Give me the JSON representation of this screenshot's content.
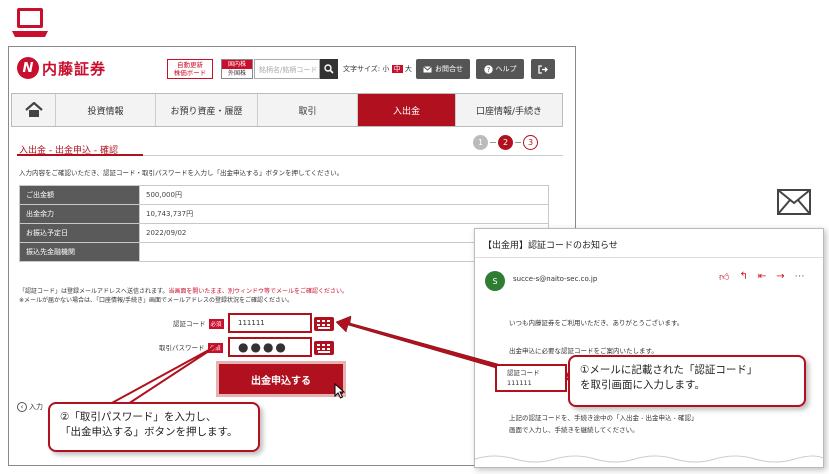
{
  "colors": {
    "brand": "#b1101f",
    "accent": "#c8102e",
    "mail_avatar": "#2e7d32"
  },
  "icons": {
    "laptop": "laptop-icon",
    "mail": "envelope-icon"
  },
  "header": {
    "logo_mark": "N",
    "logo_text": "内藤証券",
    "auto_update_line1": "自動更新",
    "auto_update_line2": "株価ボード",
    "market_top": "国内株",
    "market_bottom": "外国株",
    "search_placeholder": "銘柄名/銘柄コード",
    "font_size_label": "文字サイズ:",
    "font_small": "小",
    "font_medium": "中",
    "font_large": "大",
    "contact_label": "お問合せ",
    "help_label": "ヘルプ"
  },
  "nav": {
    "tabs": [
      {
        "label": "投資情報"
      },
      {
        "label": "お預り資産・履歴"
      },
      {
        "label": "取引"
      },
      {
        "label": "入出金"
      },
      {
        "label": "口座情報/手続き"
      }
    ]
  },
  "page": {
    "title": "入出金 - 出金申込 - 確認",
    "steps": [
      "1",
      "2",
      "3"
    ],
    "intro": "入力内容をご確認いただき、認証コード・取引パスワードを入力し「出金申込する」ボタンを押してください。"
  },
  "table": {
    "rows": [
      {
        "label": "ご出金額",
        "value": "500,000円"
      },
      {
        "label": "出金余力",
        "value": "10,743,737円"
      },
      {
        "label": "お振込予定日",
        "value": "2022/09/02"
      },
      {
        "label": "振込先金融機関",
        "value": ""
      }
    ]
  },
  "notes": {
    "line1_a": "「認証コード」は登録メールアドレスへ送信されます。",
    "line1_b": "当画面を開いたまま、別ウィンドウ等でメールをご確認ください。",
    "line2": "※メールが届かない場合は、「口座情報/手続き」画面でメールアドレスの登録状況をご確認ください。"
  },
  "form": {
    "code_label": "認証コード",
    "required": "必須",
    "code_value": "111111",
    "password_label": "取引パスワード",
    "password_value": "●●●●",
    "submit_label": "出金申込する",
    "back_label": "入力"
  },
  "callouts": {
    "c2_line1": "②「取引パスワード」を入力し、",
    "c2_line2": "「出金申込する」ボタンを押します。",
    "c1_line1": "①メールに記載された「認証コード」",
    "c1_line2": "を取引画面に入力します。"
  },
  "email": {
    "subject": "【出金用】認証コードのお知らせ",
    "avatar": "S",
    "from": "succe-s@naito-sec.co.jp",
    "greeting": "いつも内藤証券をご利用いただき、ありがとうございます。",
    "intro": "出金申込に必要な認証コードをご案内いたします。",
    "code_label": "認証コード",
    "code_value": "111111",
    "body1": "上記の認証コードを、手続き途中の「入出金 - 出金申込 - 確認」",
    "body2": "画面で入力し、手続きを継続してください。"
  }
}
